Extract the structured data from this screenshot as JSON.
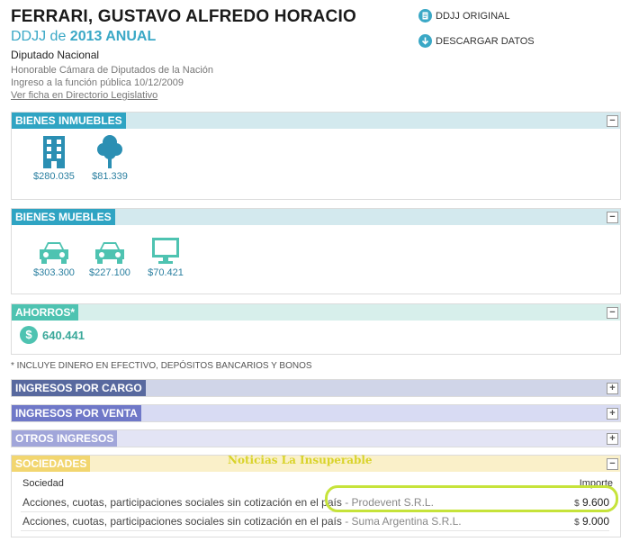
{
  "header": {
    "name": "FERRARI, GUSTAVO ALFREDO HORACIO",
    "ddjj_prefix": "DDJJ de ",
    "ddjj_year": "2013 ANUAL",
    "role": "Diputado Nacional",
    "institution": "Honorable Cámara de Diputados de la Nación",
    "ingreso": "Ingreso a la función pública 10/12/2009",
    "directorio_link": "Ver ficha en Directorio Legislativo"
  },
  "actions": {
    "original": "DDJJ ORIGINAL",
    "download": "DESCARGAR DATOS"
  },
  "inmuebles": {
    "title": "BIENES INMUEBLES",
    "items": [
      {
        "icon": "building-icon",
        "value": "$280.035"
      },
      {
        "icon": "tree-icon",
        "value": "$81.339"
      }
    ]
  },
  "muebles": {
    "title": "BIENES MUEBLES",
    "items": [
      {
        "icon": "car-icon",
        "value": "$303.300"
      },
      {
        "icon": "car-icon",
        "value": "$227.100"
      },
      {
        "icon": "monitor-icon",
        "value": "$70.421"
      }
    ]
  },
  "ahorros": {
    "title": "AHORROS*",
    "value": "640.441",
    "icon_glyph": "$"
  },
  "footnote": "* INCLUYE DINERO EN EFECTIVO, DEPÓSITOS BANCARIOS Y BONOS",
  "ingresos_cargo": {
    "title": "INGRESOS POR CARGO"
  },
  "ingresos_venta": {
    "title": "INGRESOS POR VENTA"
  },
  "otros_ingresos": {
    "title": "OTROS INGRESOS"
  },
  "sociedades": {
    "title": "SOCIEDADES",
    "col_sociedad": "Sociedad",
    "col_importe": "Importe",
    "rows": [
      {
        "desc": "Acciones, cuotas, participaciones sociales sin cotización en el país",
        "sep": " - ",
        "company": "Prodevent S.R.L.",
        "currency": "$",
        "amount": "9.600"
      },
      {
        "desc": "Acciones, cuotas, participaciones sociales sin cotización en el país",
        "sep": " - ",
        "company": "Suma Argentina S.R.L.",
        "currency": "$",
        "amount": "9.000"
      }
    ]
  },
  "watermark": "Noticias La Insuperable",
  "toggles": {
    "minus": "−",
    "plus": "+"
  },
  "colors": {
    "teal": "#2fa4c3",
    "green": "#4ec3b1",
    "indigo": "#58699f",
    "violet": "#6f78c8",
    "lilac": "#a1a6da",
    "yellow": "#f2d670",
    "highlight": "#c6e33a"
  }
}
